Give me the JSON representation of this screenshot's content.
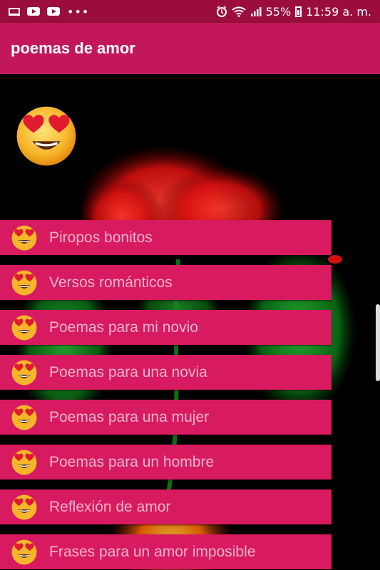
{
  "status_bar": {
    "battery": "55%",
    "time": "11:59 a. m.",
    "left_icons": [
      "laptop-icon",
      "youtube-icon",
      "youtube-icon",
      "more-dots-icon"
    ],
    "right_icons": [
      "alarm-icon",
      "wifi-icon",
      "signal-icon",
      "battery-icon"
    ]
  },
  "app_bar": {
    "title": "poemas de amor"
  },
  "colors": {
    "status_bar": "#9b0d3d",
    "app_bar": "#c2185b",
    "menu_item": "#d81b60",
    "menu_text": "#f3b3c9"
  },
  "menu": {
    "items": [
      {
        "label": "Piropos bonitos"
      },
      {
        "label": "Versos románticos"
      },
      {
        "label": "Poemas para mi novio"
      },
      {
        "label": "Poemas para una novia"
      },
      {
        "label": "Poemas para una mujer"
      },
      {
        "label": "Poemas para un hombre"
      },
      {
        "label": "Reflexión de amor"
      },
      {
        "label": "Frases para un amor imposible"
      }
    ]
  }
}
